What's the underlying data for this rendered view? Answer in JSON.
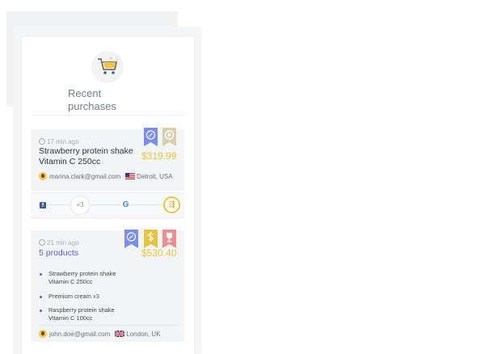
{
  "header": {
    "title_line1": "Recent",
    "title_line2": "purchases",
    "logo_icon": "shopping-cart-icon"
  },
  "purchases": [
    {
      "time": "17 min ago",
      "product_line1": "Strawberry protein shake",
      "product_line2": "Vitamin C 250cc",
      "price": "$319.99",
      "email": "marina.clark@gmail.com",
      "location": "Detroit, USA",
      "flag": "us-flag-icon",
      "badges": [
        {
          "icon": "rocket-badge-icon",
          "color": "#7b8cf4"
        },
        {
          "icon": "medal-badge-icon",
          "color": "#d8cfae"
        }
      ]
    },
    {
      "time": "21 min ago",
      "summary": "5 products",
      "price": "$530.40",
      "items": [
        {
          "line1": "Strawberry protein shake",
          "line2": "Vitamin C 250cc",
          "qty": ""
        },
        {
          "line1": "Premium cream",
          "line2": "",
          "qty": "x3"
        },
        {
          "line1": "Raspberry protein shake",
          "line2": "Vitamin C 100cc",
          "qty": ""
        }
      ],
      "email": "john.doe@gmail.com",
      "location": "London, UK",
      "flag": "uk-flag-icon",
      "badges": [
        {
          "icon": "rocket-badge-icon",
          "color": "#7b8cf4"
        },
        {
          "icon": "dollar-badge-icon",
          "color": "#e8c43c"
        },
        {
          "icon": "trophy-badge-icon",
          "color": "#ee8f8f"
        }
      ]
    }
  ],
  "social": {
    "more_count": "+3",
    "icons": [
      "facebook-icon",
      "google-icon",
      "share-icon"
    ]
  },
  "colors": {
    "accent": "#6b58d6",
    "price": "#f0c534",
    "bg": "#f4f5f7"
  }
}
